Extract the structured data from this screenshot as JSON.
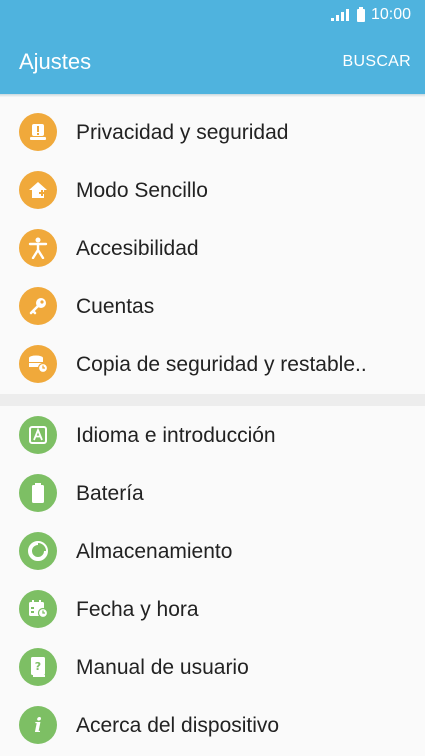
{
  "status_bar": {
    "time": "10:00"
  },
  "header": {
    "title": "Ajustes",
    "search_label": "BUSCAR"
  },
  "colors": {
    "accent": "#4fb3de",
    "orange_icon": "#f0a93b",
    "green_icon": "#7dbf64"
  },
  "groups": [
    {
      "items": [
        {
          "label": "Privacidad y seguridad",
          "icon": "alert-icon"
        },
        {
          "label": "Modo Sencillo",
          "icon": "home-icon"
        },
        {
          "label": "Accesibilidad",
          "icon": "accessibility-icon"
        },
        {
          "label": "Cuentas",
          "icon": "key-icon"
        },
        {
          "label": "Copia de seguridad y restable..",
          "icon": "backup-icon"
        }
      ]
    },
    {
      "items": [
        {
          "label": "Idioma e introducción",
          "icon": "language-icon"
        },
        {
          "label": "Batería",
          "icon": "battery-icon"
        },
        {
          "label": "Almacenamiento",
          "icon": "storage-icon"
        },
        {
          "label": "Fecha y hora",
          "icon": "calendar-icon"
        },
        {
          "label": "Manual de usuario",
          "icon": "manual-icon"
        },
        {
          "label": "Acerca del dispositivo",
          "icon": "info-icon"
        }
      ]
    }
  ]
}
